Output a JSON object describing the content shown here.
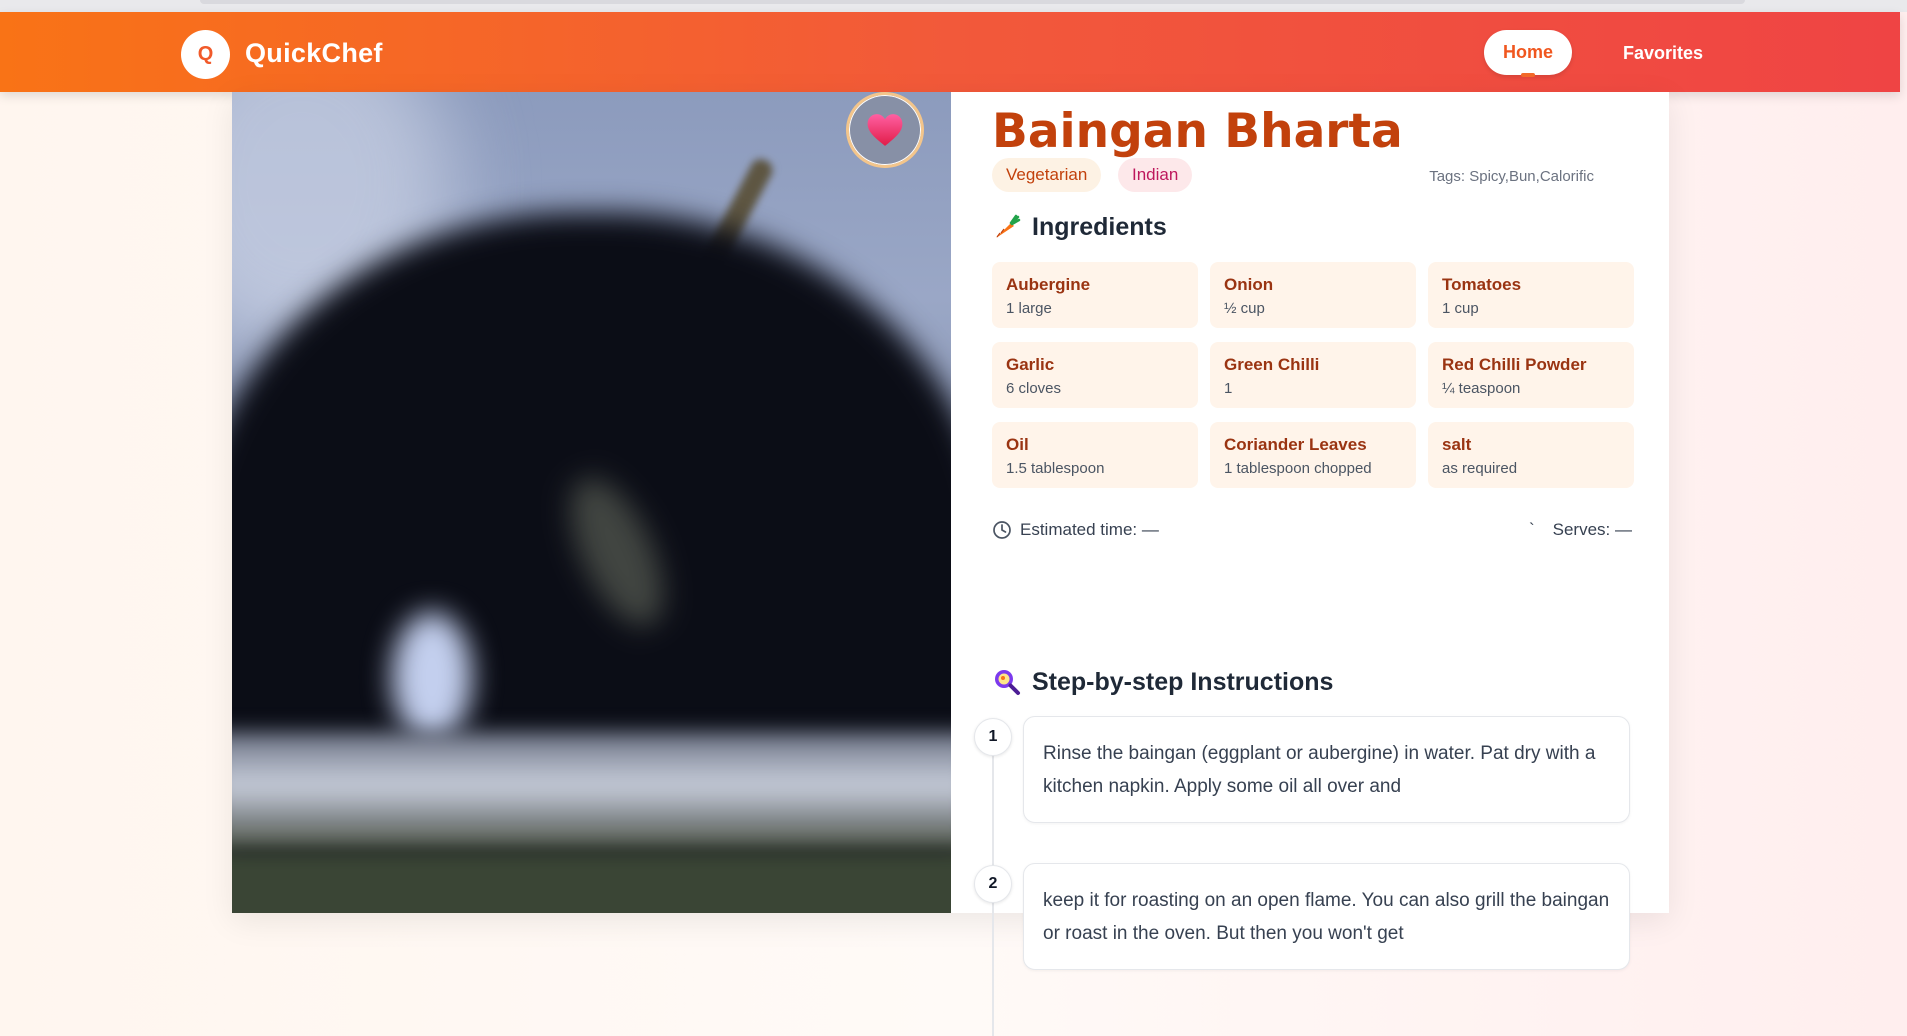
{
  "header": {
    "logo_letter": "Q",
    "app_name": "QuickChef",
    "nav": {
      "home": "Home",
      "favorites": "Favorites"
    }
  },
  "recipe": {
    "title": "Baingan Bharta",
    "category": "Vegetarian",
    "cuisine": "Indian",
    "tags_text": "Tags: Spicy,Bun,Calorific",
    "favorite_icon": "heart-icon",
    "ingredients_heading": "Ingredients",
    "ingredients": [
      {
        "name": "Aubergine",
        "qty": "1 large"
      },
      {
        "name": "Onion",
        "qty": "½ cup"
      },
      {
        "name": "Tomatoes",
        "qty": "1 cup"
      },
      {
        "name": "Garlic",
        "qty": "6 cloves"
      },
      {
        "name": "Green Chilli",
        "qty": "1"
      },
      {
        "name": "Red Chilli Powder",
        "qty": "¼ teaspoon"
      },
      {
        "name": "Oil",
        "qty": "1.5 tablespoon"
      },
      {
        "name": "Coriander Leaves",
        "qty": "1 tablespoon chopped"
      },
      {
        "name": "salt",
        "qty": "as required"
      }
    ],
    "estimated_time": "Estimated time: —",
    "serves_mark": "`",
    "serves": "Serves: —",
    "instructions_heading": "Step-by-step Instructions",
    "steps": [
      {
        "num": "1",
        "text": "Rinse the baingan (eggplant or aubergine) in water. Pat dry with a kitchen napkin. Apply some oil all over and"
      },
      {
        "num": "2",
        "text": "keep it for roasting on an open flame. You can also grill the baingan or roast in the oven. But then you won't get"
      }
    ]
  },
  "colors": {
    "brand_start": "#f97316",
    "brand_end": "#ef4444",
    "title": "#c2410c",
    "ingredient_name": "#9a3412"
  }
}
